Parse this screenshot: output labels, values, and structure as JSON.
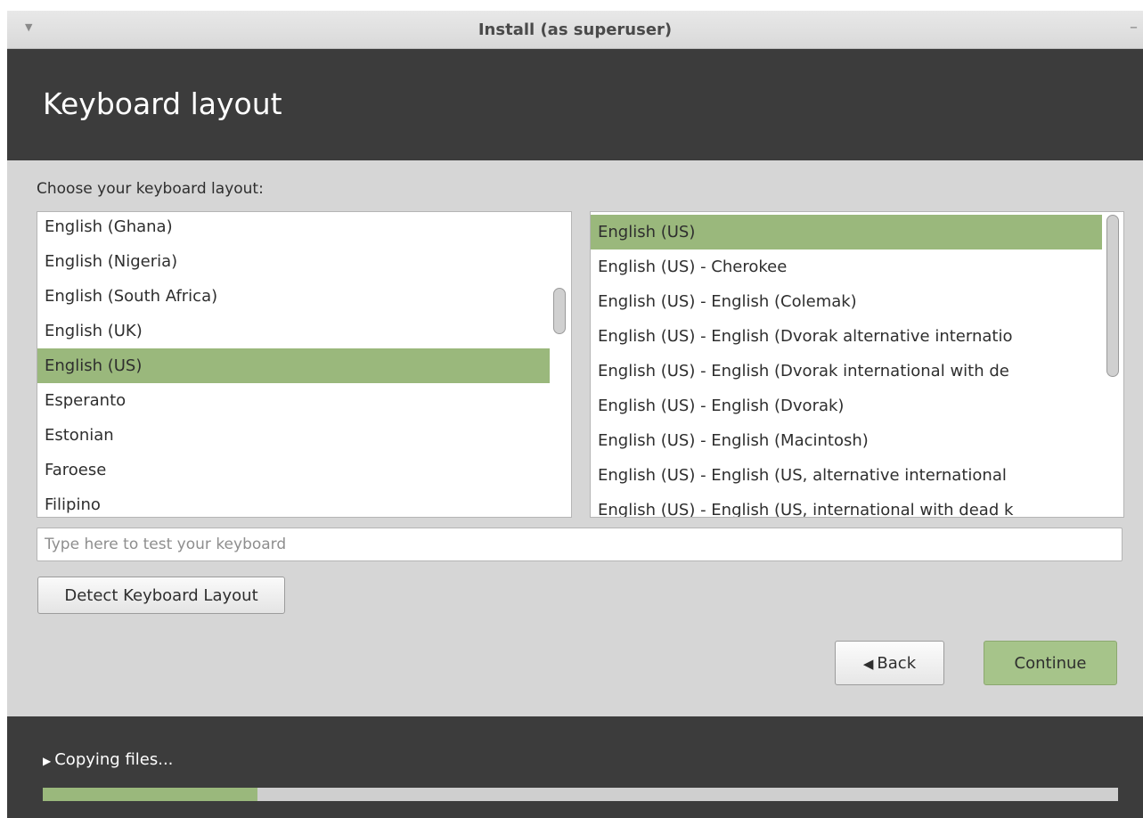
{
  "window": {
    "title": "Install (as superuser)",
    "menu_icon": "chevron-down-icon",
    "minimize_icon": "minimize-icon"
  },
  "header": {
    "title": "Keyboard layout"
  },
  "main": {
    "prompt": "Choose your keyboard layout:",
    "layouts": [
      "English (Ghana)",
      "English (Nigeria)",
      "English (South Africa)",
      "English (UK)",
      "English (US)",
      "Esperanto",
      "Estonian",
      "Faroese",
      "Filipino"
    ],
    "layouts_selected": "English (US)",
    "variants": [
      "English (US)",
      "English (US) - Cherokee",
      "English (US) - English (Colemak)",
      "English (US) - English (Dvorak alternative internatio",
      "English (US) - English (Dvorak international with de",
      "English (US) - English (Dvorak)",
      "English (US) - English (Macintosh)",
      "English (US) - English (US, alternative international",
      "English (US) - English (US, international with dead k"
    ],
    "variants_selected": "English (US)",
    "test_placeholder": "Type here to test your keyboard",
    "test_value": "",
    "detect_label": "Detect Keyboard Layout",
    "back_label": "Back",
    "continue_label": "Continue"
  },
  "footer": {
    "status": "Copying files...",
    "progress": 0.2
  },
  "colors": {
    "header_bg": "#3c3c3c",
    "selection": "#9ab87c",
    "continue_bg": "#a6c48a",
    "window_bg": "#d6d6d6"
  }
}
